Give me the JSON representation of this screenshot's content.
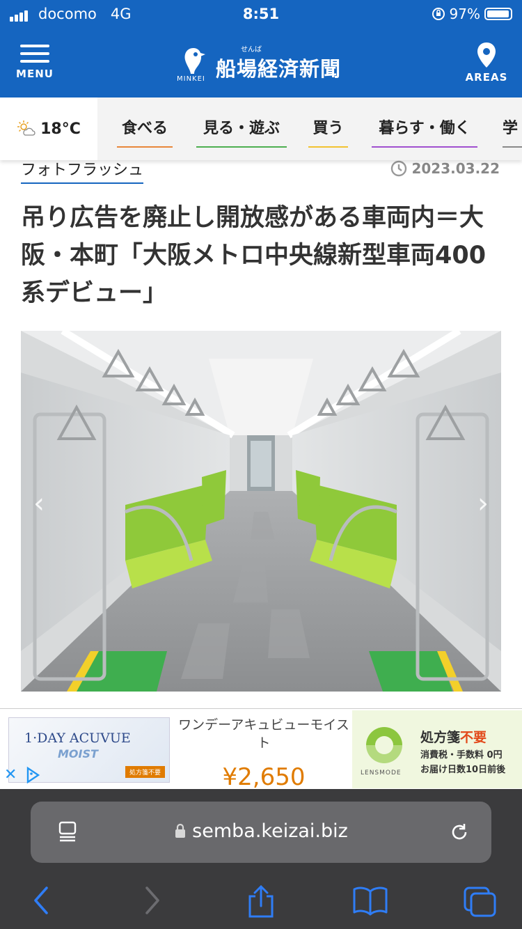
{
  "status_bar": {
    "carrier": "docomo",
    "network": "4G",
    "time": "8:51",
    "battery": "97%"
  },
  "header": {
    "menu_label": "MENU",
    "site_name": "船場経済新聞",
    "site_ruby": "せんば",
    "logo_text": "MINKEI",
    "areas_label": "AREAS",
    "brand_color": "#1565c0"
  },
  "weather": {
    "temp": "18°C"
  },
  "categories": [
    {
      "label": "食べる",
      "color": "#e8873a"
    },
    {
      "label": "見る・遊ぶ",
      "color": "#4caf50"
    },
    {
      "label": "買う",
      "color": "#f2c230"
    },
    {
      "label": "暮らす・働く",
      "color": "#a04fcf"
    },
    {
      "label": "学"
    }
  ],
  "article": {
    "section": "フォトフラッシュ",
    "date": "2023.03.22",
    "title": "吊り広告を廃止し開放感がある車両内＝大阪・本町「大阪メトロ中央線新型車両400系デビュー」"
  },
  "ad": {
    "product_brand": "1·DAY ACUVUE",
    "product_sub": "MOIST",
    "product_tag": "処方箋不要",
    "name": "ワンデーアキュビューモイスト",
    "price": "¥2,650",
    "shop": "LENSMODE",
    "note_1a": "処方箋",
    "note_1b": "不要",
    "note_2": "消費税・手数料 0円",
    "note_3": "お届け日数10日前後"
  },
  "browser": {
    "url": "semba.keizai.biz"
  }
}
